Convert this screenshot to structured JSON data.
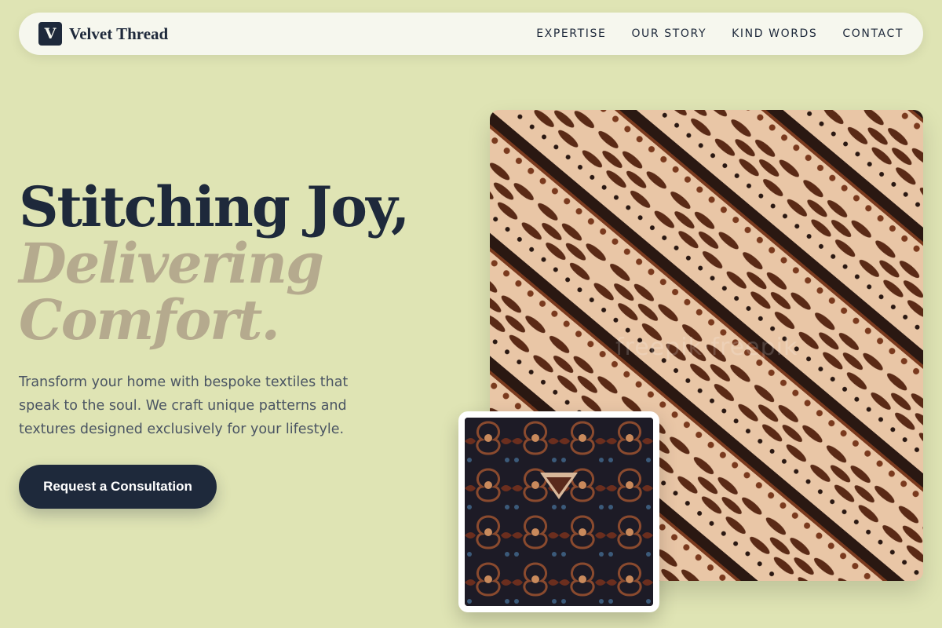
{
  "nav": {
    "logo_letter": "V",
    "brand": "Velvet Thread",
    "links": [
      "EXPERTISE",
      "OUR STORY",
      "KIND WORDS",
      "CONTACT"
    ]
  },
  "hero": {
    "title_line1": "Stitching Joy,",
    "title_line2": "Delivering",
    "title_line3": "Comfort.",
    "subtitle": "Transform your home with bespoke textiles that speak to the soul. We craft unique patterns and textures designed exclusively for your lifestyle.",
    "cta_label": "Request a Consultation"
  },
  "images": {
    "main": "batik-parang-fabric-image",
    "inset": "dark-batik-fabric-image",
    "watermark": "freepik·freepik"
  },
  "colors": {
    "background": "#dfe4b4",
    "navy": "#1e293b",
    "muted_gold": "#b5aa8e",
    "nav_bg": "#f6f7ee"
  }
}
